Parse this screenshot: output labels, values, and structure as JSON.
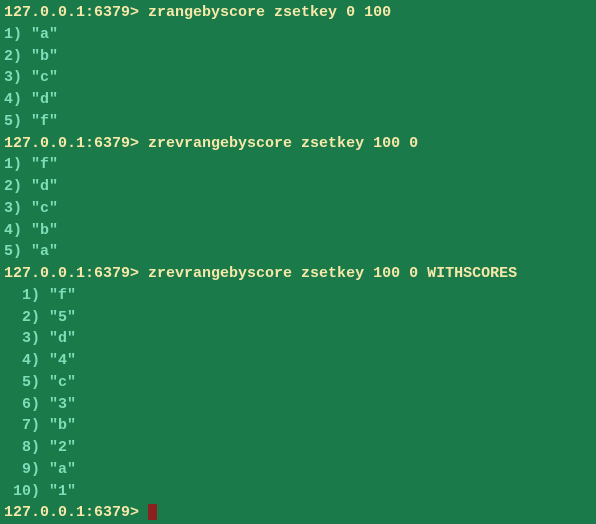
{
  "prompt": "127.0.0.1:6379>",
  "entries": [
    {
      "command": "zrangebyscore zsetkey 0 100",
      "results": [
        "\"a\"",
        "\"b\"",
        "\"c\"",
        "\"d\"",
        "\"f\""
      ],
      "indent": ""
    },
    {
      "command": "zrevrangebyscore zsetkey 100 0",
      "results": [
        "\"f\"",
        "\"d\"",
        "\"c\"",
        "\"b\"",
        "\"a\""
      ],
      "indent": ""
    },
    {
      "command": "zrevrangebyscore zsetkey 100 0 WITHSCORES",
      "results": [
        "\"f\"",
        "\"5\"",
        "\"d\"",
        "\"4\"",
        "\"c\"",
        "\"3\"",
        "\"b\"",
        "\"2\"",
        "\"a\"",
        "\"1\""
      ],
      "indent": " "
    }
  ]
}
